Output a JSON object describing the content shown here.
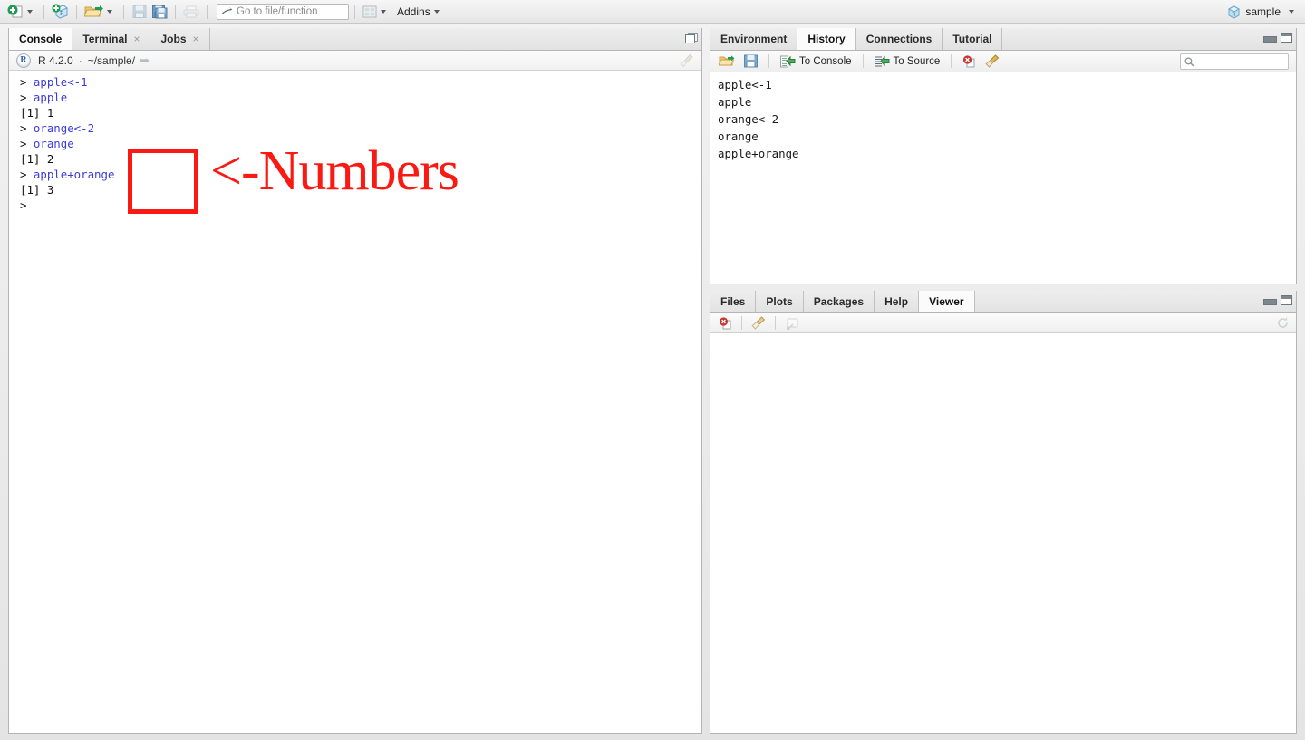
{
  "toolbar": {
    "new_file_label": "new-file",
    "new_project_label": "new-project",
    "open_file_label": "open-file",
    "save_label": "save",
    "save_all_label": "save-all",
    "print_label": "print",
    "goto_placeholder": "Go to file/function",
    "panes_label": "workspace-panes",
    "addins_label": "Addins"
  },
  "project": {
    "name": "sample"
  },
  "console": {
    "tabs": [
      {
        "label": "Console",
        "active": true,
        "closable": false
      },
      {
        "label": "Terminal",
        "active": false,
        "closable": true
      },
      {
        "label": "Jobs",
        "active": false,
        "closable": true
      }
    ],
    "close_glyph": "×",
    "header": {
      "version": "R 4.2.0",
      "separator": "·",
      "path": "~/sample/",
      "shortcut_icon": "arrow-right-icon",
      "clear_icon": "broom-icon"
    },
    "lines": [
      {
        "prompt": "> ",
        "input": "apple<-1",
        "output": ""
      },
      {
        "prompt": "> ",
        "input": "apple",
        "output": ""
      },
      {
        "prompt": "",
        "input": "",
        "output": "[1] 1"
      },
      {
        "prompt": "> ",
        "input": "orange<-2",
        "output": ""
      },
      {
        "prompt": "> ",
        "input": "orange",
        "output": ""
      },
      {
        "prompt": "",
        "input": "",
        "output": "[1] 2"
      },
      {
        "prompt": "> ",
        "input": "apple+orange",
        "output": ""
      },
      {
        "prompt": "",
        "input": "",
        "output": "[1] 3"
      },
      {
        "prompt": "> ",
        "input": "",
        "output": ""
      }
    ]
  },
  "annotation": {
    "text": "<-Numbers",
    "color": "#fb1a13",
    "box_label": "empty-red-square"
  },
  "environment_pane": {
    "tabs": [
      {
        "label": "Environment",
        "active": false
      },
      {
        "label": "History",
        "active": true
      },
      {
        "label": "Connections",
        "active": false
      },
      {
        "label": "Tutorial",
        "active": false
      }
    ],
    "toolbar": {
      "load_label": "load-history",
      "save_label": "save-history",
      "to_console_label": "To Console",
      "to_source_label": "To Source",
      "remove_label": "remove-entry",
      "clear_label": "clear-all"
    },
    "search_placeholder": "",
    "search_value": "",
    "history_entries": [
      "apple<-1",
      "apple",
      "orange<-2",
      "orange",
      "apple+orange"
    ]
  },
  "viewer_pane": {
    "tabs": [
      {
        "label": "Files",
        "active": false
      },
      {
        "label": "Plots",
        "active": false
      },
      {
        "label": "Packages",
        "active": false
      },
      {
        "label": "Help",
        "active": false
      },
      {
        "label": "Viewer",
        "active": true
      }
    ],
    "toolbar": {
      "stop_label": "stop-clear",
      "clear_label": "clear-viewer",
      "popout_label": "show-in-new-window",
      "refresh_label": "refresh"
    },
    "content": ""
  }
}
